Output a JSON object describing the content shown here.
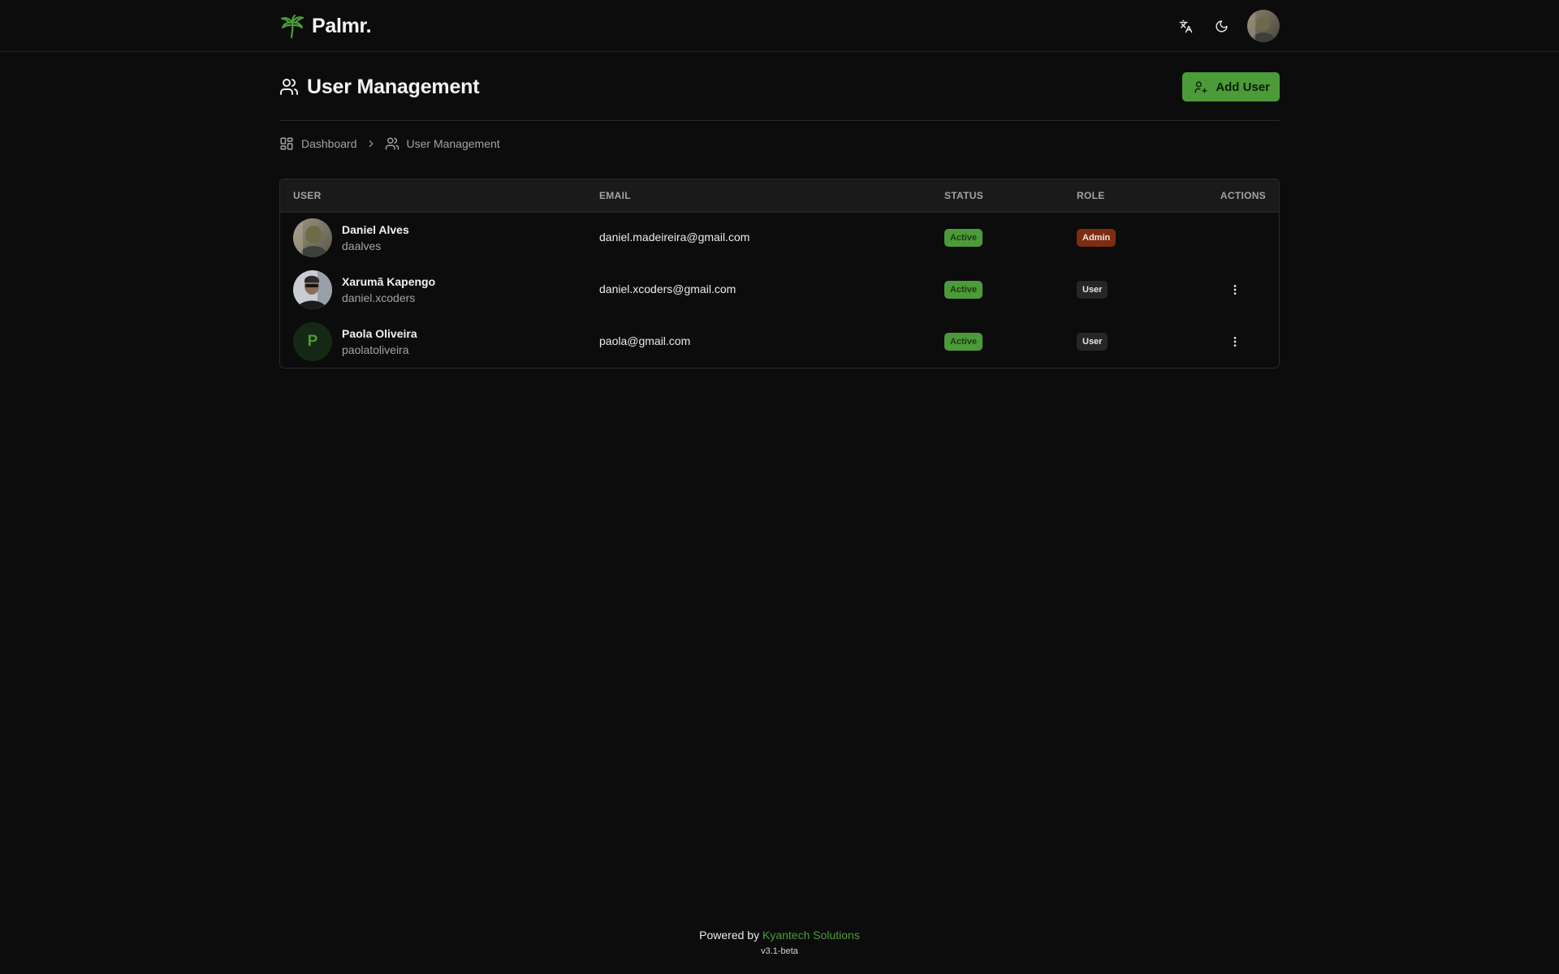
{
  "app": {
    "name": "Palmr.",
    "accent_color": "#4c9b39"
  },
  "navbar": {
    "language_icon": "translate-icon",
    "theme_icon": "moon-icon",
    "profile_avatar": "user-avatar-photo"
  },
  "page": {
    "title": "User Management",
    "title_icon": "users-icon",
    "add_user_label": "Add User"
  },
  "breadcrumb": {
    "dashboard_label": "Dashboard",
    "current_label": "User Management"
  },
  "table": {
    "columns": {
      "user": "USER",
      "email": "EMAIL",
      "status": "STATUS",
      "role": "ROLE",
      "actions": "ACTIONS"
    },
    "rows": [
      {
        "name": "Daniel Alves",
        "username": "daalves",
        "email": "daniel.madeireira@gmail.com",
        "status": "Active",
        "role": "Admin",
        "avatar": "photo",
        "has_actions": false
      },
      {
        "name": "Xarumã Kapengo",
        "username": "daniel.xcoders",
        "email": "daniel.xcoders@gmail.com",
        "status": "Active",
        "role": "User",
        "avatar": "photo",
        "has_actions": true
      },
      {
        "name": "Paola Oliveira",
        "username": "paolatoliveira",
        "email": "paola@gmail.com",
        "status": "Active",
        "role": "User",
        "avatar_initial": "P",
        "has_actions": true
      }
    ]
  },
  "footer": {
    "powered_by": "Powered by",
    "company": "Kyantech Solutions",
    "version": "v3.1-beta"
  }
}
